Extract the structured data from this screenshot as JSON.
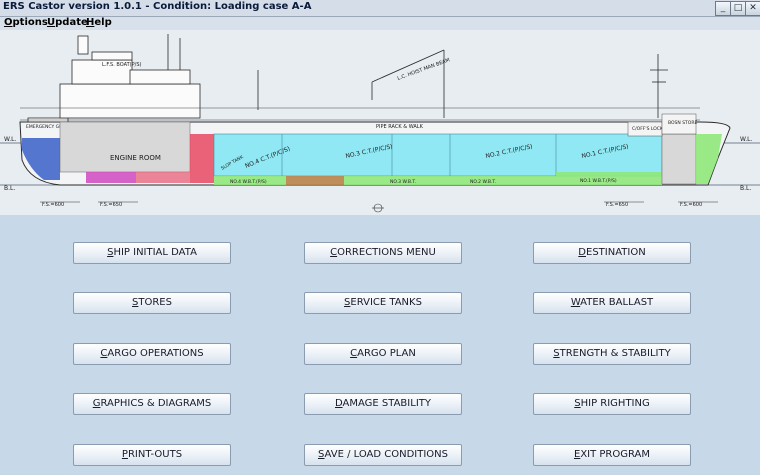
{
  "window": {
    "title": "ERS Castor version 1.0.1 - Condition: Loading case A-A",
    "controls": {
      "minimize": "_",
      "maximize": "□",
      "close": "✕"
    }
  },
  "menu": [
    "Options",
    "Update",
    "Help"
  ],
  "ship_labels": {
    "lfs_boat": "L.F.S. BOAT(P/S)",
    "emergency_gen": "EMERGENCY GEN. ROOM",
    "engine_room": "ENGINE ROOM",
    "lc_hoist": "L.C. HOIST MAN BEAM",
    "pipe_rack": "PIPE RACK & WALK",
    "cofferdam_locker": "C/OFF'S LOCKER",
    "boson_store": "BOSN STORE",
    "slop_tank": "SLOP TANK",
    "ct4": "NO.4 C.T.(P/C/S)",
    "ct3": "NO.3 C.T.(P/C/S)",
    "ct2": "NO.2 C.T.(P/C/S)",
    "ct1": "NO.1 C.T.(P/C/S)",
    "wbt4": "NO.4 W.B.T.(P/S)",
    "wbt3": "NO.3 W.B.T.",
    "wbt2": "NO.2 W.B.T.",
    "wbt1": "NO.1 W.B.T.(P/S)",
    "wl_left": "W.L.",
    "wl_right": "W.L.",
    "bl_left": "B.L.",
    "bl_right": "B.L.",
    "fs600_left": "F.S.=600",
    "fs650_left": "F.S.=650",
    "fs650_right": "F.S.=650",
    "fs600_right": "F.S.=600"
  },
  "buttons": [
    [
      "SHIP INITIAL DATA",
      "CORRECTIONS MENU",
      "DESTINATION"
    ],
    [
      "STORES",
      "SERVICE TANKS",
      "WATER BALLAST"
    ],
    [
      "CARGO OPERATIONS",
      "CARGO PLAN",
      "STRENGTH & STABILITY"
    ],
    [
      "GRAPHICS & DIAGRAMS",
      "DAMAGE STABILITY",
      "SHIP RIGHTING"
    ],
    [
      "PRINT-OUTS",
      "SAVE / LOAD CONDITIONS",
      "EXIT PROGRAM"
    ]
  ],
  "colors": {
    "background": "#c7d8e8",
    "cargo_tank": "#8fe8f4",
    "ballast_tank": "#8fe87a",
    "engine_room": "#d8d8d8",
    "aft_peak": "#3a5fc8",
    "fuel_tank": "#d048c0",
    "slop_tank": "#b8844a",
    "pump_room": "#e84860"
  }
}
